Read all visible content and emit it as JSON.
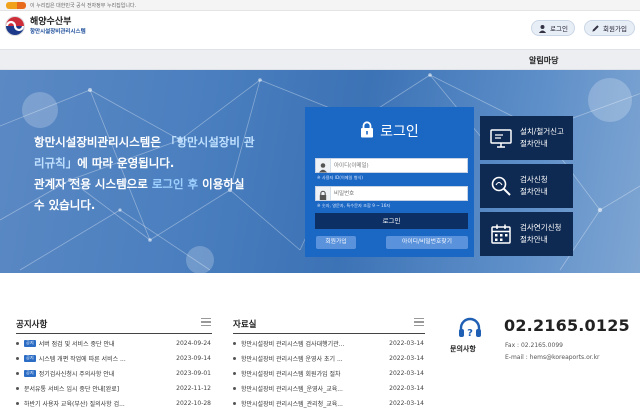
{
  "gov_banner": {
    "text": "이 누리집은 대한민국 공식 전자정부 누리집입니다."
  },
  "header": {
    "org_name": "해양수산부",
    "system_name": "항만시설장비관리시스템",
    "login_label": "로그인",
    "join_label": "회원가입"
  },
  "nav": {
    "notice_menu": "알림마당"
  },
  "hero": {
    "line1_a": "항만시설장비관리시스템은 ",
    "line1_b": "「항만시설장비 관",
    "line2_a": "리규칙」",
    "line2_b": "에 따라 운영됩니다.",
    "line3_a": "관계자 전용 시스템으로 ",
    "line3_b": "로그인 후",
    "line3_c": " 이용하실",
    "line4": "수 있습니다."
  },
  "login": {
    "title": "로그인",
    "id_placeholder": "아이디(이메일)",
    "id_hint": "※ 사용자 ID(이메일 형식)",
    "pw_placeholder": "비밀번호",
    "pw_hint": "※ 숫자, 영문자, 특수문자 조합 9 ~ 16자",
    "submit_label": "로그인",
    "register_label": "회원가입",
    "find_label": "아이디/비밀번호찾기"
  },
  "side_buttons": [
    {
      "line1": "설치/철거신고",
      "line2": "절차안내",
      "icon": "monitor-icon"
    },
    {
      "line1": "검사신청",
      "line2": "절차안내",
      "icon": "search-inspect-icon"
    },
    {
      "line1": "검사연기신청",
      "line2": "절차안내",
      "icon": "calendar-icon"
    }
  ],
  "notices": {
    "title": "공지사항",
    "new_badge": "공지",
    "items": [
      {
        "text": "서버 점검 및 서비스 중단 안내",
        "date": "2024-09-24",
        "badge": true
      },
      {
        "text": "시스템 개편 작업에 따른 서비스 ...",
        "date": "2023-09-14",
        "badge": true
      },
      {
        "text": "정기검사신청시 주의사항 안내",
        "date": "2023-09-01",
        "badge": true
      },
      {
        "text": "문서유통 서비스 임시 중단 안내[완료]",
        "date": "2022-11-12",
        "badge": false
      },
      {
        "text": "하반기 사용자 교육(부산) 질의사항 검...",
        "date": "2022-10-28",
        "badge": false
      }
    ]
  },
  "resources": {
    "title": "자료실",
    "items": [
      {
        "text": "항만시설장비 관리시스템 검사대행기관...",
        "date": "2022-03-14"
      },
      {
        "text": "항만시설장비 관리시스템 운영사 초기 ...",
        "date": "2022-03-14"
      },
      {
        "text": "항만시설장비 관리시스템 회원가입 절차",
        "date": "2022-03-14"
      },
      {
        "text": "항만시설장비 관리시스템_운영사_교육...",
        "date": "2022-03-14"
      },
      {
        "text": "항만시설장비 관리시스템_관리청_교육...",
        "date": "2022-03-14"
      }
    ]
  },
  "contact": {
    "label": "문의사항",
    "phone": "02.2165.0125",
    "fax": "Fax : 02.2165.0099",
    "email": "E-mail : hems@koreaports.or.kr"
  },
  "colors": {
    "login_panel": "#1b67c4",
    "side_button": "#0f2a52",
    "submit_button": "#0c2f66"
  }
}
